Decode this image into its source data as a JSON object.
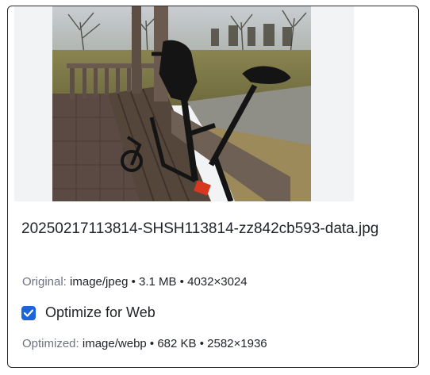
{
  "file": {
    "name": "20250217113814-SHSH113814-zz842cb593-data.jpg"
  },
  "original": {
    "label": "Original:",
    "info": "image/jpeg • 3.1 MB • 4032×3024"
  },
  "optimize": {
    "label": "Optimize for Web",
    "checked": true
  },
  "optimized": {
    "label": "Optimized:",
    "info": "image/webp • 682 KB • 2582×1936"
  },
  "colors": {
    "checkbox": "#1a66d8",
    "border": "#2b2b2b",
    "muted_label": "#6b7280"
  }
}
